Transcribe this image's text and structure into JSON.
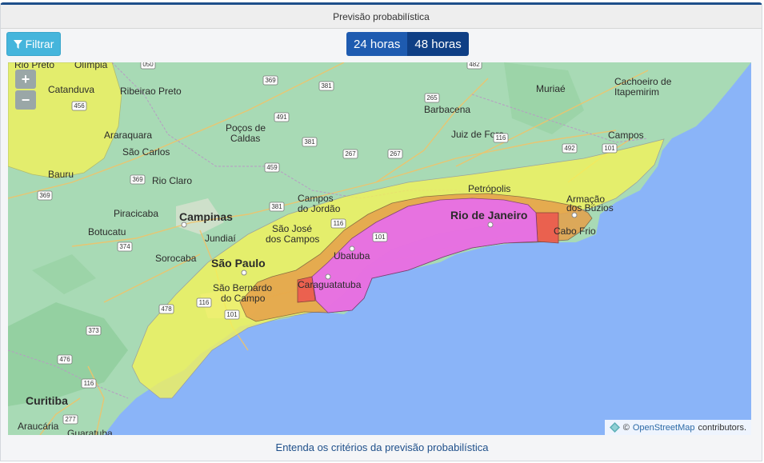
{
  "panel": {
    "title": "Previsão probabilística"
  },
  "toolbar": {
    "filter_label": "Filtrar"
  },
  "period_toggle": {
    "options": [
      "24 horas",
      "48 horas"
    ],
    "selected": "24 horas"
  },
  "map": {
    "zoom_in": "+",
    "zoom_out": "−",
    "attribution_prefix": "©",
    "attribution_link": "OpenStreetMap",
    "attribution_suffix": "contributors.",
    "cities": {
      "rio_preto": "Rio Preto",
      "olimpia": "Olímpia",
      "catanduva": "Catanduva",
      "ribeirao_preto": "Ribeirao Preto",
      "araraquara": "Araraquara",
      "sao_carlos": "São Carlos",
      "bauru": "Bauru",
      "rio_claro": "Rio Claro",
      "pocos_de_caldas_1": "Poços de",
      "pocos_de_caldas_2": "Caldas",
      "barbacena": "Barbacena",
      "muriae": "Muriaé",
      "cachoeiro_1": "Cachoeiro de",
      "cachoeiro_2": "Itapemirim",
      "juiz_de_fora": "Juiz de Fora",
      "campos": "Campos",
      "campos_jordao_1": "Campos",
      "campos_jordao_2": "do Jordão",
      "petropolis": "Petrópolis",
      "armacao_1": "Armação",
      "armacao_2": "dos Búzios",
      "piracicaba": "Piracicaba",
      "campinas": "Campinas",
      "botucatu": "Botucatu",
      "jundiai": "Jundiaí",
      "sao_jose_1": "São José",
      "sao_jose_2": "dos Campos",
      "rio_de_janeiro": "Rio de Janeiro",
      "cabo_frio": "Cabo Frio",
      "sorocaba": "Sorocaba",
      "sao_paulo": "São Paulo",
      "ubatuba": "Ubatuba",
      "caraguatatuba": "Caraguatatuba",
      "sao_bernardo_1": "São Bernardo",
      "sao_bernardo_2": "do Campo",
      "curitiba": "Curitiba",
      "araucaria": "Araucária",
      "guaratuba": "Guaratuba"
    },
    "highways": [
      "050",
      "369",
      "381",
      "482",
      "265",
      "491",
      "116",
      "381",
      "267",
      "267",
      "492",
      "101",
      "456",
      "369",
      "459",
      "369",
      "381",
      "116",
      "374",
      "101",
      "478",
      "116",
      "101",
      "373",
      "476",
      "116",
      "277"
    ]
  },
  "footer": {
    "criteria_link": "Entenda os critérios da previsão probabilística"
  },
  "colors": {
    "header_accent": "#1e4f8a",
    "filter_button": "#45b5dc",
    "toggle_active": "#1e5bb0",
    "toggle_inactive": "#0f3f85",
    "ocean": "#8ab4f8",
    "land": "#a8dab5",
    "level_low": "#f4f35a",
    "level_moderate": "#e6a04a",
    "level_high": "#ec5a4f",
    "level_very_high": "#e86cf0"
  }
}
